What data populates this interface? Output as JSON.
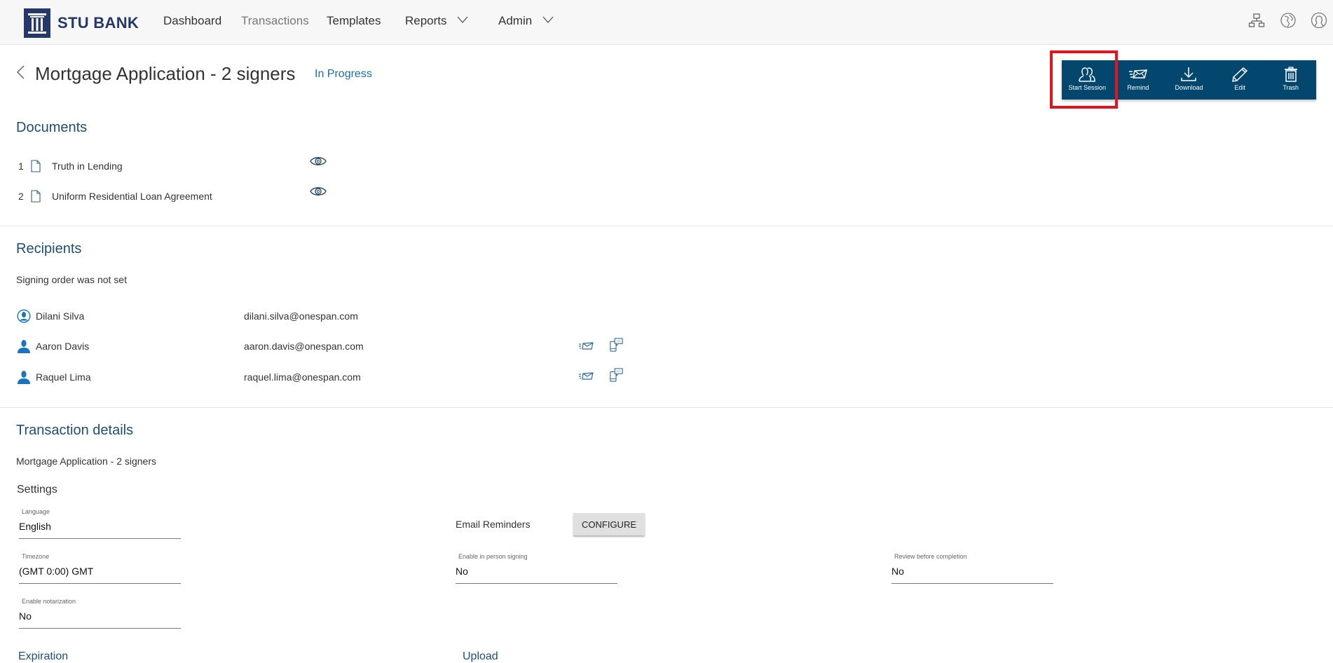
{
  "header": {
    "brand": "STU BANK",
    "nav": [
      {
        "label": "Dashboard",
        "active": false,
        "dropdown": false
      },
      {
        "label": "Transactions",
        "active": true,
        "dropdown": false
      },
      {
        "label": "Templates",
        "active": false,
        "dropdown": false
      },
      {
        "label": "Reports",
        "active": false,
        "dropdown": true
      },
      {
        "label": "Admin",
        "active": false,
        "dropdown": true
      }
    ],
    "right_icons": [
      "sitemap-icon",
      "globe-icon",
      "user-profile-icon"
    ]
  },
  "page": {
    "title": "Mortgage Application - 2 signers",
    "status": "In Progress",
    "status_color": "#1a6fb0"
  },
  "actions": [
    {
      "label": "Start Session",
      "icon": "start-session-icon",
      "highlighted": true
    },
    {
      "label": "Remind",
      "icon": "remind-envelope-icon"
    },
    {
      "label": "Download",
      "icon": "download-icon"
    },
    {
      "label": "Edit",
      "icon": "pencil-icon"
    },
    {
      "label": "Trash",
      "icon": "trash-icon"
    }
  ],
  "documents": {
    "heading": "Documents",
    "items": [
      {
        "index": "1",
        "name": "Truth in Lending"
      },
      {
        "index": "2",
        "name": "Uniform Residential Loan Agreement"
      }
    ]
  },
  "recipients": {
    "heading": "Recipients",
    "signing_order": "Signing order was not set",
    "items": [
      {
        "name": "Dilani Silva",
        "email": "dilani.silva@onespan.com",
        "owner": true
      },
      {
        "name": "Aaron Davis",
        "email": "aaron.davis@onespan.com",
        "owner": false
      },
      {
        "name": "Raquel Lima",
        "email": "raquel.lima@onespan.com",
        "owner": false
      }
    ]
  },
  "details": {
    "heading": "Transaction details",
    "name": "Mortgage Application - 2 signers",
    "settings_heading": "Settings",
    "email_reminders_label": "Email Reminders",
    "configure_label": "CONFIGURE",
    "fields": {
      "language": {
        "label": "Language",
        "value": "English"
      },
      "timezone": {
        "label": "Timezone",
        "value": "(GMT 0:00) GMT"
      },
      "in_person": {
        "label": "Enable in person signing",
        "value": "No"
      },
      "review": {
        "label": "Review before completion",
        "value": "No"
      },
      "notarization": {
        "label": "Enable notarization",
        "value": "No"
      }
    },
    "cut_headings": [
      "Expiration",
      "Upload"
    ]
  },
  "colors": {
    "brand": "#24386b",
    "action_bar": "#03476f",
    "section_heading": "#1d4e74",
    "highlight": "#e3141e",
    "recipient_icon": "#1a74bd"
  }
}
